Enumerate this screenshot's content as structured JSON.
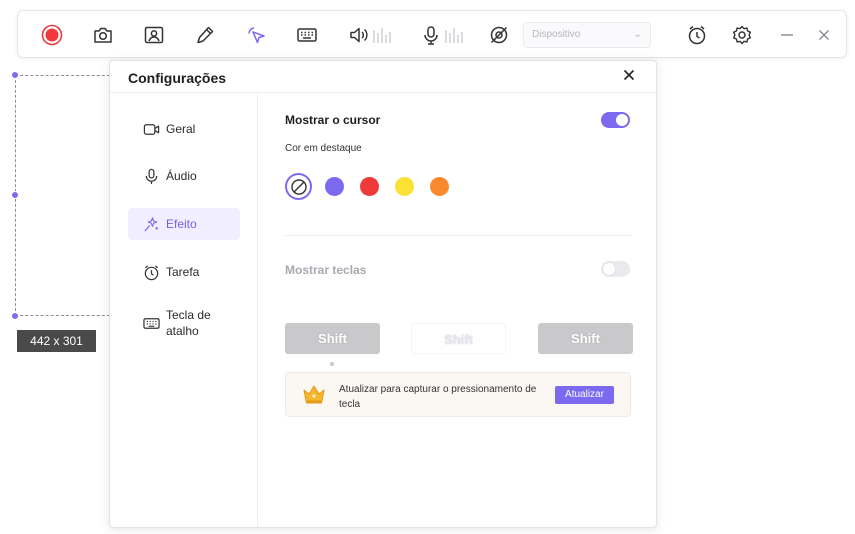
{
  "toolbar": {
    "device_select": {
      "value": "Dispositivo"
    },
    "icons": [
      "record-icon",
      "camera-icon",
      "webcam-icon",
      "pen-icon",
      "cursor-icon",
      "keyboard-icon",
      "speaker-icon",
      "microphone-icon",
      "effect-icon",
      "timer-icon",
      "settings-icon",
      "minimize-icon",
      "close-icon"
    ]
  },
  "capture": {
    "size_label": "442 x 301"
  },
  "dialog": {
    "title": "Configurações",
    "nav": [
      {
        "label": "Geral",
        "icon": "camera-icon"
      },
      {
        "label": "Áudio",
        "icon": "microphone-icon"
      },
      {
        "label": "Efeito",
        "icon": "effect-icon",
        "active": true
      },
      {
        "label": "Tarefa",
        "icon": "alarm-icon"
      },
      {
        "label": "Tecla de atalho",
        "icon": "keyboard-icon"
      }
    ],
    "cursor": {
      "title": "Mostrar o cursor",
      "enabled": true,
      "highlight_label": "Cor em destaque",
      "colors": [
        "#7b6af0",
        "#f03a3a",
        "#fae234",
        "#fb8a2e"
      ],
      "selected": "none"
    },
    "keys": {
      "title": "Mostrar teclas",
      "enabled": false,
      "samples": [
        "Shift",
        "Shift",
        "Shift"
      ]
    },
    "upgrade": {
      "message": "Atualizar para capturar o pressionamento de tecla",
      "button": "Atualizar"
    }
  },
  "colors": {
    "accent": "#7b6af0",
    "record": "#f0393d"
  }
}
